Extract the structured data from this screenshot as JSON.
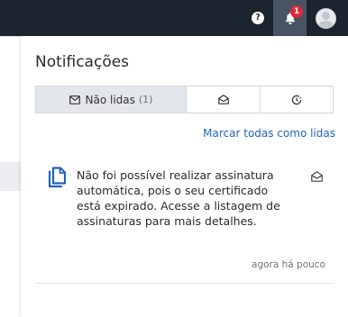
{
  "topbar": {
    "help_label": "?",
    "notifications_badge": "1",
    "colors": {
      "bar": "#1c2430",
      "active_button": "#495463",
      "badge": "#e0263b"
    }
  },
  "panel": {
    "title": "Notificações",
    "tabs": [
      {
        "label": "Não lidas",
        "count": "(1)",
        "icon": "envelope-closed-icon",
        "active": true
      },
      {
        "icon": "envelope-open-icon",
        "active": false
      },
      {
        "icon": "clock-history-icon",
        "active": false
      }
    ],
    "mark_all_label": "Marcar todas como lidas",
    "link_color": "#1f65b8",
    "notifications": [
      {
        "icon": "document-copy-icon",
        "text": "Não foi possível realizar assinatura automática, pois o seu certificado está expirado. Acesse a listagem de assinaturas para mais detalhes.",
        "time": "agora há pouco",
        "action_icon": "envelope-open-icon"
      }
    ]
  }
}
